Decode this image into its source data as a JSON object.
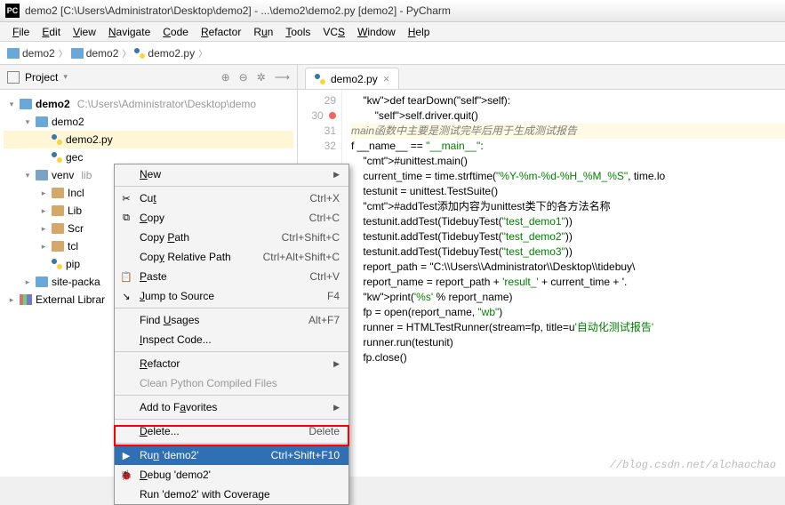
{
  "title": "demo2 [C:\\Users\\Administrator\\Desktop\\demo2] - ...\\demo2\\demo2.py [demo2] - PyCharm",
  "menubar": [
    "File",
    "Edit",
    "View",
    "Navigate",
    "Code",
    "Refactor",
    "Run",
    "Tools",
    "VCS",
    "Window",
    "Help"
  ],
  "breadcrumb": [
    "demo2",
    "demo2",
    "demo2.py"
  ],
  "sidebar": {
    "title": "Project",
    "tree": {
      "root": "demo2",
      "root_path": "C:\\Users\\Administrator\\Desktop\\demo",
      "demo2": "demo2",
      "demo2py": "demo2.py",
      "gec": "gec",
      "venv": "venv",
      "venv_hint": "lib",
      "incl": "Incl",
      "lib": "Lib",
      "scr": "Scr",
      "tcl": "tcl",
      "pip": "pip",
      "site": "site-packa",
      "external": "External Librar"
    }
  },
  "editor": {
    "tab": "demo2.py",
    "line_start": 29,
    "lines": [
      "",
      "    def tearDown(self):",
      "        self.driver.quit()",
      "",
      "main函数中主要是测试完毕后用于生成测试报告",
      "f __name__ == \"__main__\":",
      "    #unittest.main()",
      "    current_time = time.strftime(\"%Y-%m-%d-%H_%M_%S\", time.lo",
      "    testunit = unittest.TestSuite()",
      "    #addTest添加内容为unittest类下的各方法名称",
      "    testunit.addTest(TidebuyTest(\"test_demo1\"))",
      "    testunit.addTest(TidebuyTest(\"test_demo2\"))",
      "    testunit.addTest(TidebuyTest(\"test_demo3\"))",
      "    report_path = \"C:\\\\Users\\\\Administrator\\\\Desktop\\\\tidebuy\\",
      "    report_name = report_path + 'result_' + current_time + '.",
      "    print('%s' % report_name)",
      "    fp = open(report_name, \"wb\")",
      "",
      "    runner = HTMLTestRunner(stream=fp, title=u'自动化测试报告'",
      "",
      "    runner.run(testunit)",
      "",
      "    fp.close()"
    ]
  },
  "context_menu": [
    {
      "label": "New",
      "sub": true
    },
    {
      "sep": true
    },
    {
      "icon": "✂",
      "label": "Cut",
      "sc": "Ctrl+X"
    },
    {
      "icon": "⧉",
      "label": "Copy",
      "sc": "Ctrl+C"
    },
    {
      "label": "Copy Path",
      "sc": "Ctrl+Shift+C"
    },
    {
      "label": "Copy Relative Path",
      "sc": "Ctrl+Alt+Shift+C"
    },
    {
      "icon": "📋",
      "label": "Paste",
      "sc": "Ctrl+V"
    },
    {
      "icon": "↘",
      "label": "Jump to Source",
      "sc": "F4"
    },
    {
      "sep": true
    },
    {
      "label": "Find Usages",
      "sc": "Alt+F7"
    },
    {
      "label": "Inspect Code..."
    },
    {
      "sep": true
    },
    {
      "label": "Refactor",
      "sub": true
    },
    {
      "label": "Clean Python Compiled Files",
      "disabled": true
    },
    {
      "sep": true
    },
    {
      "label": "Add to Favorites",
      "sub": true
    },
    {
      "sep": true
    },
    {
      "label": "Delete...",
      "sc": "Delete"
    },
    {
      "sep": true
    },
    {
      "icon": "▶",
      "label": "Run 'demo2'",
      "sc": "Ctrl+Shift+F10",
      "hl": true
    },
    {
      "icon": "🐞",
      "label": "Debug 'demo2'"
    },
    {
      "label": "Run 'demo2' with Coverage"
    }
  ],
  "watermark": "//blog.csdn.net/alchaochao"
}
